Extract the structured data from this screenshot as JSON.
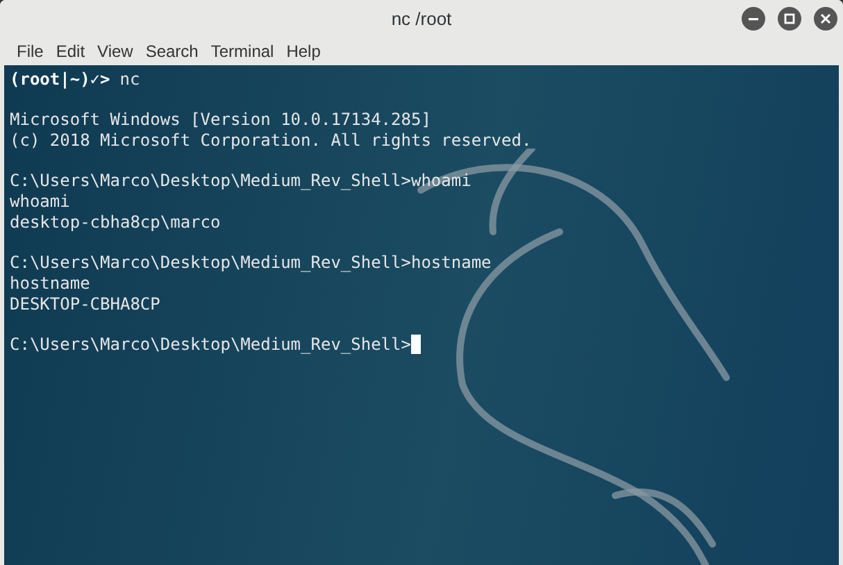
{
  "window": {
    "title": "nc /root"
  },
  "menu": [
    "File",
    "Edit",
    "View",
    "Search",
    "Terminal",
    "Help"
  ],
  "terminal": {
    "lines": [
      {
        "kind": "prompt",
        "prompt": "(root|~)✓>",
        "text": "nc"
      },
      {
        "kind": "blank"
      },
      {
        "kind": "output",
        "text": "Microsoft Windows [Version 10.0.17134.285]"
      },
      {
        "kind": "output",
        "text": "(c) 2018 Microsoft Corporation. All rights reserved."
      },
      {
        "kind": "blank"
      },
      {
        "kind": "output",
        "text": "C:\\Users\\Marco\\Desktop\\Medium_Rev_Shell>whoami"
      },
      {
        "kind": "output",
        "text": "whoami"
      },
      {
        "kind": "output",
        "text": "desktop-cbha8cp\\marco"
      },
      {
        "kind": "blank"
      },
      {
        "kind": "output",
        "text": "C:\\Users\\Marco\\Desktop\\Medium_Rev_Shell>hostname"
      },
      {
        "kind": "output",
        "text": "hostname"
      },
      {
        "kind": "output",
        "text": "DESKTOP-CBHA8CP"
      },
      {
        "kind": "blank"
      },
      {
        "kind": "output",
        "text": "C:\\Users\\Marco\\Desktop\\Medium_Rev_Shell>",
        "cursor": true
      }
    ]
  }
}
